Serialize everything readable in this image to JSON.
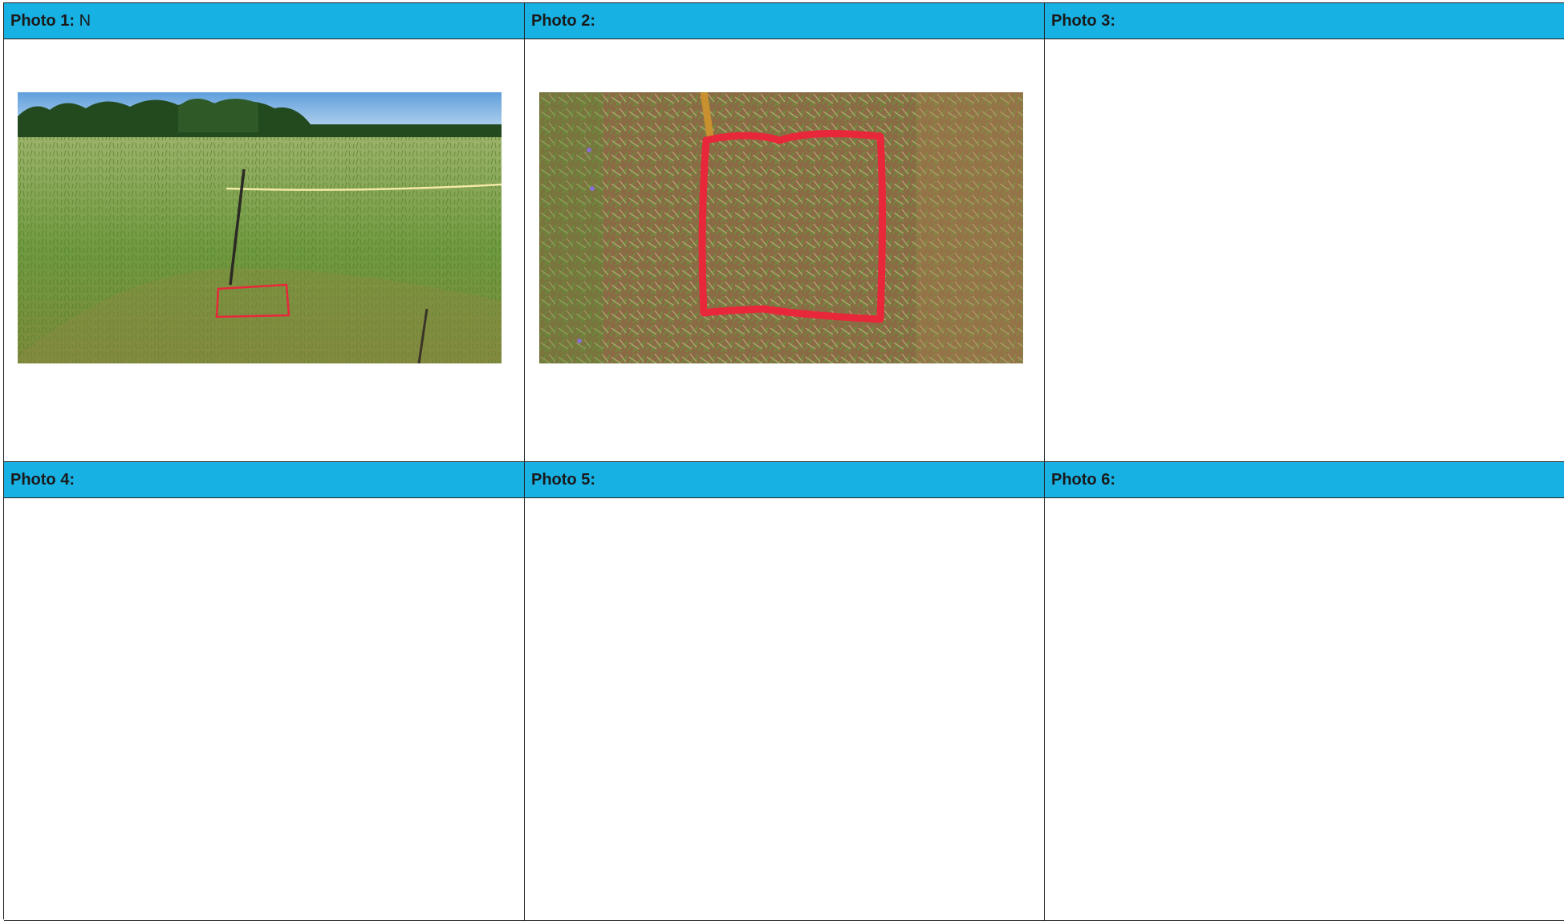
{
  "photos": [
    {
      "label": "Photo 1:",
      "caption": "N",
      "has_image": true
    },
    {
      "label": "Photo 2:",
      "caption": "",
      "has_image": true
    },
    {
      "label": "Photo 3:",
      "caption": "",
      "has_image": false
    },
    {
      "label": "Photo 4:",
      "caption": "",
      "has_image": false
    },
    {
      "label": "Photo 5:",
      "caption": "",
      "has_image": false
    },
    {
      "label": "Photo 6:",
      "caption": "",
      "has_image": false
    }
  ],
  "colors": {
    "header_bg": "#17b1e3",
    "border": "#222222",
    "paint_marker": "#e8283a"
  }
}
